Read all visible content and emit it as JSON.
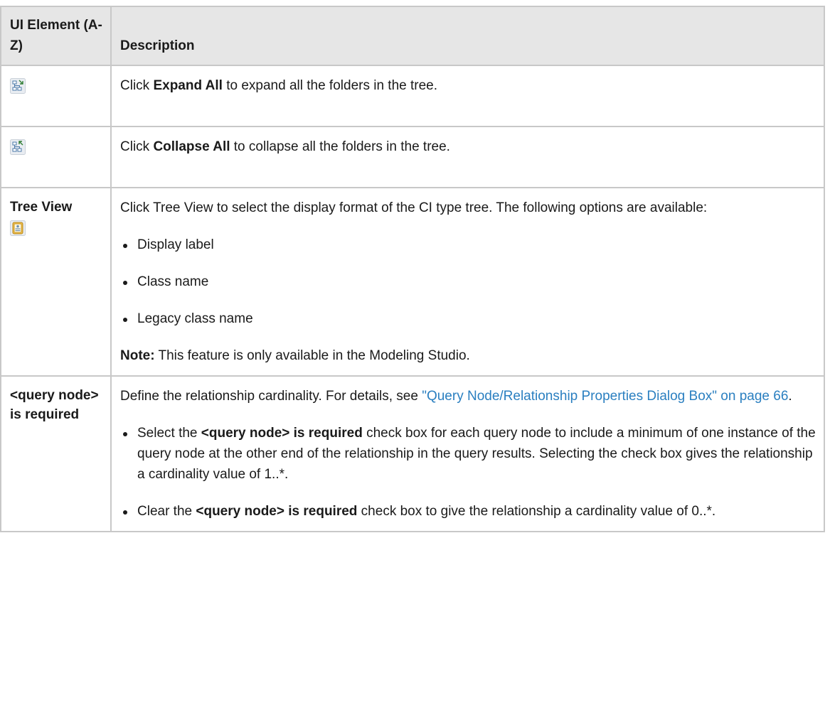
{
  "table": {
    "header": {
      "element_col": "UI Element (A-Z)",
      "description_col": "Description"
    },
    "rows": [
      {
        "element_icon": "expand-all-icon",
        "desc_pre": "Click ",
        "desc_bold": "Expand All",
        "desc_post": " to expand all the folders in the tree."
      },
      {
        "element_icon": "collapse-all-icon",
        "desc_pre": "Click ",
        "desc_bold": "Collapse All",
        "desc_post": " to collapse all the folders in the tree."
      },
      {
        "element_label": "Tree View",
        "element_icon": "tree-view-icon",
        "desc_intro": "Click Tree View to select the display format of the CI type tree. The following options are available:",
        "options": [
          "Display label",
          "Class name",
          "Legacy class name"
        ],
        "note_label": "Note:",
        "note_text": " This feature is only available in the Modeling Studio."
      },
      {
        "element_label": "<query node> is required",
        "desc_intro_pre": "Define the relationship cardinality. For details, see ",
        "desc_link": "\"Query Node/Relationship Properties Dialog Box\" on page 66",
        "desc_intro_post": ".",
        "bullet1_pre": "Select the ",
        "bullet1_bold": "<query node> is required",
        "bullet1_post": " check box for each query node to include a minimum of one instance of the query node at the other end of the relationship in the query results. Selecting the check box gives the relationship a cardinality value of 1..*.",
        "bullet2_pre": "Clear the ",
        "bullet2_bold": "<query node> is required",
        "bullet2_post": " check box to give the relationship a cardinality value of 0..*."
      }
    ]
  },
  "colors": {
    "header_bg": "#e6e6e6",
    "border": "#c8c8c8",
    "link": "#2a7fc0"
  }
}
